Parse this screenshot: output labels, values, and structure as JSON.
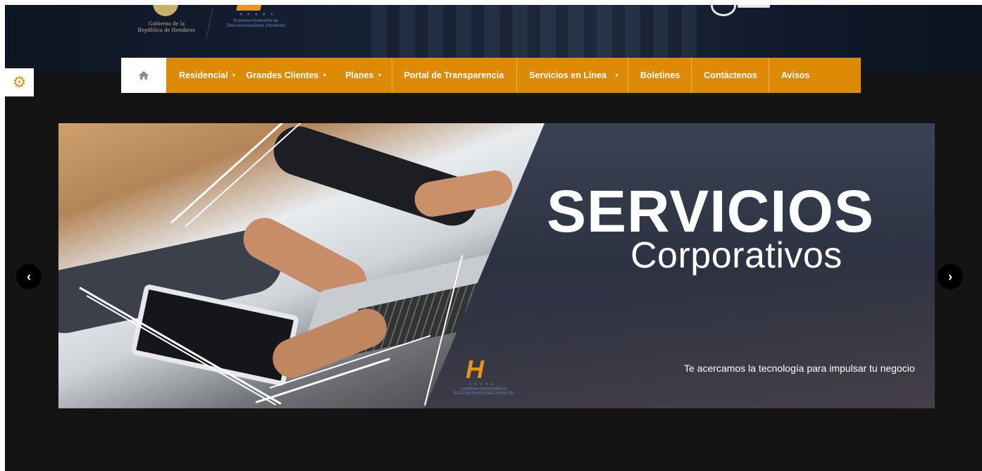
{
  "header": {
    "gov_logo_line1": "Gobierno de la",
    "gov_logo_line2": "República de Honduras",
    "hondutel_logo_text": "Empresa Hondureña de Telecomunicaciones (Hondutel)"
  },
  "settings": {
    "icon": "gear-icon"
  },
  "nav": {
    "home_icon": "home-icon",
    "items": [
      {
        "label": "Residencial",
        "dropdown": true
      },
      {
        "label": "Grandes Clientes",
        "dropdown": true
      },
      {
        "label": "Planes",
        "dropdown": true
      },
      {
        "label": "Portal de Transparencia",
        "dropdown": false
      },
      {
        "label": "Servicios en Línea",
        "dropdown": true
      },
      {
        "label": "Boletines",
        "dropdown": false
      },
      {
        "label": "Contáctenos",
        "dropdown": false
      },
      {
        "label": "Avisos",
        "dropdown": false
      }
    ],
    "caret": "▼"
  },
  "slider": {
    "title": "SERVICIOS",
    "subtitle": "Corporativos",
    "tagline": "Te acercamos la tecnología para impulsar tu negocio",
    "logo_letter": "H",
    "logo_stars": "★ ★ ★ ★ ★",
    "logo_text": "EMPRESA HONDUREÑA DE TELECOMUNICACIONES HONDUTEL",
    "prev_glyph": "‹",
    "next_glyph": "›"
  },
  "colors": {
    "nav_bg": "#dd8a06",
    "accent": "#e9941b",
    "page_bg": "#141414"
  }
}
